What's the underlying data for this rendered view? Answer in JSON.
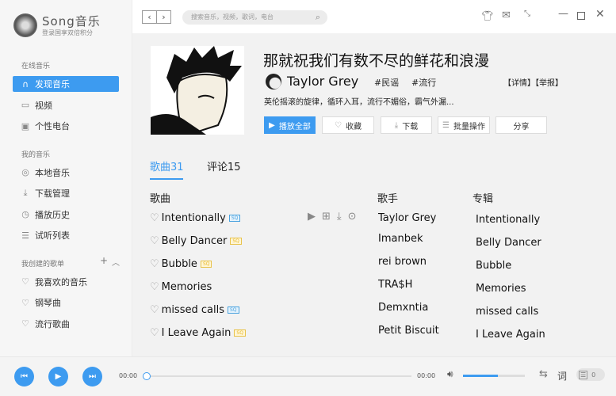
{
  "app": {
    "name": "Song音乐",
    "subtitle": "登录国享双倍积分"
  },
  "sidebar": {
    "sections": [
      {
        "title": "在线音乐",
        "items": [
          {
            "label": "发现音乐",
            "icon": "headphones-icon",
            "active": true
          },
          {
            "label": "视频",
            "icon": "video-icon"
          },
          {
            "label": "个性电台",
            "icon": "radio-icon"
          }
        ]
      },
      {
        "title": "我的音乐",
        "items": [
          {
            "label": "本地音乐",
            "icon": "music-disc-icon"
          },
          {
            "label": "下载管理",
            "icon": "download-icon"
          },
          {
            "label": "播放历史",
            "icon": "clock-icon"
          },
          {
            "label": "试听列表",
            "icon": "list-icon"
          }
        ]
      },
      {
        "title": "我创建的歌单",
        "items": [
          {
            "label": "我喜欢的音乐",
            "icon": "heart-icon"
          },
          {
            "label": "钢琴曲",
            "icon": "heart-icon"
          },
          {
            "label": "流行歌曲",
            "icon": "heart-icon"
          }
        ]
      }
    ]
  },
  "search": {
    "placeholder": "搜索音乐，视频，歌词，电台"
  },
  "playlist": {
    "title": "那就祝我们有数不尽的鲜花和浪漫",
    "artist": "Taylor Grey",
    "tags": [
      "#民谣",
      "#流行"
    ],
    "links": "【详情】【举报】",
    "description": "英伦摇滚的旋律，循环入耳，流行不媚俗，霸气外漏...",
    "buttons": {
      "play_all": "播放全部",
      "collect": "收藏",
      "download": "下载",
      "batch": "批量操作",
      "share": "分享"
    }
  },
  "tabs": [
    {
      "label": "歌曲31",
      "active": true
    },
    {
      "label": "评论15"
    }
  ],
  "columns": {
    "song": "歌曲",
    "artist": "歌手",
    "album": "专辑"
  },
  "songs": [
    {
      "title": "Intentionally",
      "quality": "SQ",
      "quality_color": "blue",
      "artist": "Taylor Grey",
      "album": "Intentionally"
    },
    {
      "title": "Belly Dancer",
      "quality": "SQ",
      "quality_color": "yellow",
      "artist": "Imanbek",
      "album": "Belly Dancer"
    },
    {
      "title": "Bubble",
      "quality": "SQ",
      "quality_color": "yellow",
      "artist": "rei brown",
      "album": "Bubble"
    },
    {
      "title": "Memories",
      "quality": "",
      "artist": "TRA$H",
      "album": "Memories"
    },
    {
      "title": "missed calls",
      "quality": "SQ",
      "quality_color": "blue",
      "artist": "Demxntia",
      "album": "missed calls"
    },
    {
      "title": "I Leave Again",
      "quality": "SQ",
      "quality_color": "yellow",
      "artist": "Petit Biscuit",
      "album": "I Leave Again"
    }
  ],
  "player": {
    "current_time": "00:00",
    "total_time": "00:00",
    "progress": 0,
    "volume_percent": 57,
    "lyrics_label": "词",
    "queue_count": "0"
  },
  "colors": {
    "accent": "#3d9bf0"
  }
}
